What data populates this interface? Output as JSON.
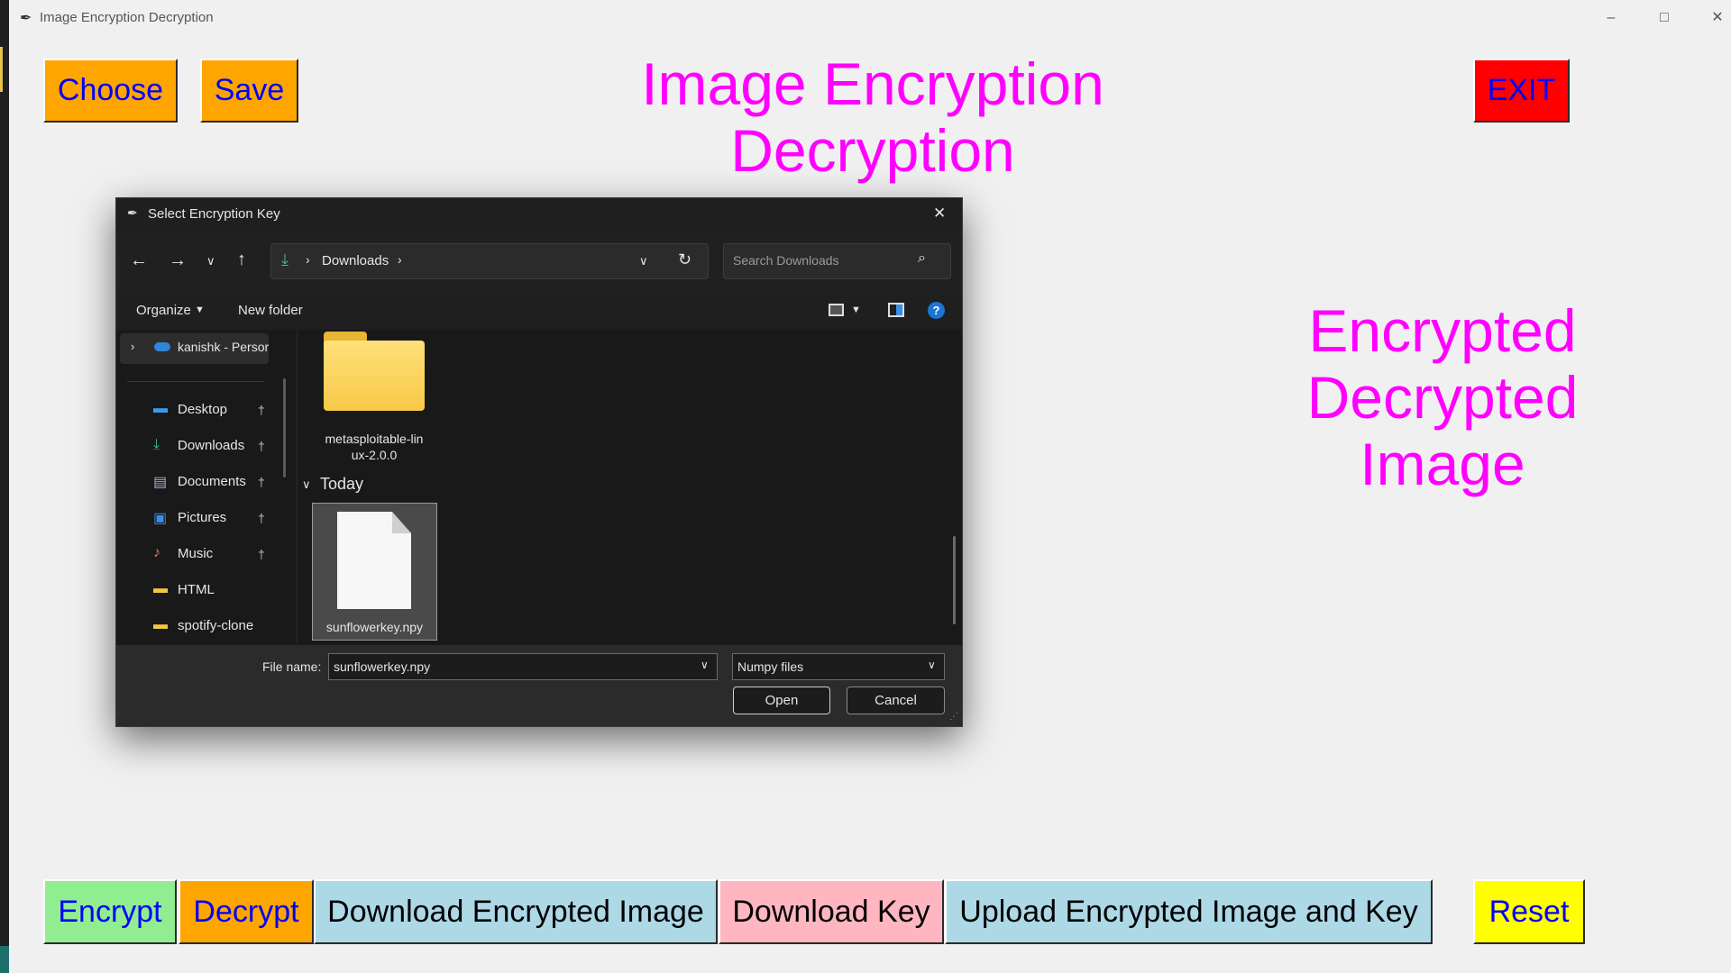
{
  "window": {
    "title": "Image Encryption Decryption",
    "icon": "feather-icon",
    "controls": [
      "minimize-icon",
      "maximize-icon",
      "close-icon"
    ]
  },
  "app": {
    "choose_label": "Choose",
    "save_label": "Save",
    "exit_label": "EXIT",
    "heading_line1": "Image Encryption",
    "heading_line2": "Decryption",
    "preview_line1": "Encrypted",
    "preview_line2": "Decrypted",
    "preview_line3": "Image",
    "encrypt_label": "Encrypt",
    "decrypt_label": "Decrypt",
    "download_encrypted_label": "Download Encrypted Image",
    "download_key_label": "Download Key",
    "upload_label": "Upload Encrypted Image and Key",
    "reset_label": "Reset",
    "colors": {
      "orange": "#ffa500",
      "red": "#ff0000",
      "magenta": "#ff00ff",
      "green": "#90ee90",
      "lightblue": "#add8e6",
      "pink": "#ffb6c1",
      "yellow": "#ffff00",
      "button_text": "#0000ff"
    }
  },
  "dialog": {
    "title": "Select Encryption Key",
    "breadcrumb": "Downloads",
    "search_placeholder": "Search Downloads",
    "organize_label": "Organize",
    "new_folder_label": "New folder",
    "nav_cloud": "kanishk - Persor",
    "nav_items": [
      {
        "label": "Desktop",
        "icon": "desktop-icon",
        "pinned": true
      },
      {
        "label": "Downloads",
        "icon": "download-icon",
        "pinned": true
      },
      {
        "label": "Documents",
        "icon": "document-icon",
        "pinned": true
      },
      {
        "label": "Pictures",
        "icon": "pictures-icon",
        "pinned": true
      },
      {
        "label": "Music",
        "icon": "music-icon",
        "pinned": true
      },
      {
        "label": "HTML",
        "icon": "folder-icon",
        "pinned": false
      },
      {
        "label": "spotify-clone",
        "icon": "folder-icon",
        "pinned": false
      }
    ],
    "folder_name_line1": "metasploitable-lin",
    "folder_name_line2": "ux-2.0.0",
    "group_today": "Today",
    "file_name": "sunflowerkey.npy",
    "filename_label": "File name:",
    "filename_value": "sunflowerkey.npy",
    "filetype_value": "Numpy files",
    "open_label": "Open",
    "cancel_label": "Cancel"
  }
}
